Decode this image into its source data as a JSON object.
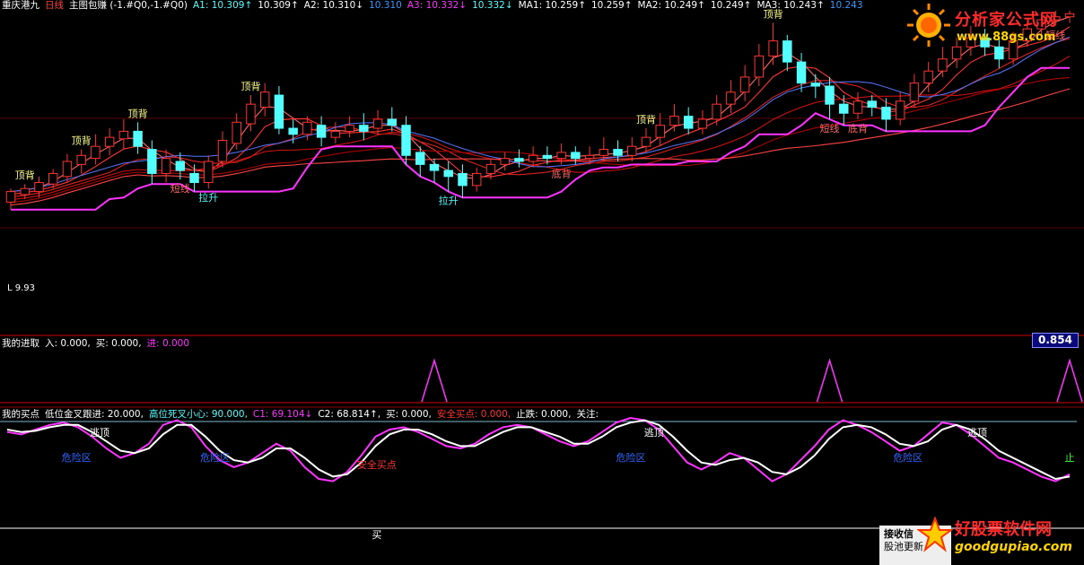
{
  "colors": {
    "bg": "#000000",
    "up_candle": "#ff3333",
    "down_candle": "#54ffff",
    "divider": "#7a0000",
    "ma_red": "#ff2a2a",
    "stop_line_magenta": "#ff33ff",
    "green_line": "#33ff33",
    "blue_dots": "#4466ff",
    "white_line": "#ffffff",
    "yellow_text": "#ffff00",
    "cyan_text": "#54ffff"
  },
  "header": {
    "stock": "重庆港九",
    "period": "日线",
    "indicator": "主图包赚 (-1.#Q0,-1.#Q0)",
    "a1": "A1: 10.309↑",
    "a1b": "10.309↑",
    "a2": "A2: 10.310↓",
    "a2b": "10.310",
    "a3": "A3: 10.332↓",
    "a3b": "10.332↓",
    "ma1": "MA1: 10.259↑",
    "ma1b": "10.259↑",
    "ma2": "MA2: 10.249↑",
    "ma2b": "10.249↑",
    "ma3": "MA3: 10.243↑",
    "ma3b": "10.243"
  },
  "panel2": {
    "title": "我的进取",
    "ru": "入: 0.000,",
    "mai": "买: 0.000,",
    "jin": "进: 0.000",
    "value_box": "0.854"
  },
  "panel3": {
    "title": "我的买点",
    "p1": "低位金叉跟进: 20.000,",
    "p2": "高位死叉小心: 90.000,",
    "c1": "C1: 69.104↓",
    "c2": "C2: 68.814↑,",
    "buy": "买: 0.000,",
    "safe": "安全买点: 0.000,",
    "stop": "止跌: 0.000,",
    "watch": "关注:"
  },
  "watermark_top": {
    "name": "分析家公式网",
    "url": "www.88gs.com"
  },
  "watermark_bottom": {
    "name": "好股票软件网",
    "url": "goodgupiao.com",
    "notice1": "接收信",
    "notice2": "股池更新"
  },
  "chart_data": [
    {
      "type": "candlestick",
      "price_range": [
        9.2,
        11.2
      ],
      "low_label": "L 9.93",
      "candles": [
        [
          9.93,
          10.0,
          9.88,
          10.02
        ],
        [
          9.98,
          10.02,
          9.95,
          10.05
        ],
        [
          10.0,
          10.06,
          9.96,
          10.1
        ],
        [
          10.05,
          10.12,
          10.02,
          10.15
        ],
        [
          10.1,
          10.2,
          10.06,
          10.25
        ],
        [
          10.18,
          10.24,
          10.12,
          10.28
        ],
        [
          10.22,
          10.3,
          10.18,
          10.38
        ],
        [
          10.3,
          10.36,
          10.24,
          10.42
        ],
        [
          10.35,
          10.4,
          10.28,
          10.48
        ],
        [
          10.4,
          10.3,
          10.25,
          10.46
        ],
        [
          10.28,
          10.12,
          10.05,
          10.34
        ],
        [
          10.12,
          10.22,
          10.06,
          10.28
        ],
        [
          10.2,
          10.14,
          10.08,
          10.26
        ],
        [
          10.12,
          10.06,
          10.0,
          10.18
        ],
        [
          10.06,
          10.2,
          10.02,
          10.24
        ],
        [
          10.2,
          10.34,
          10.16,
          10.4
        ],
        [
          10.32,
          10.46,
          10.28,
          10.52
        ],
        [
          10.45,
          10.58,
          10.4,
          10.64
        ],
        [
          10.56,
          10.66,
          10.5,
          10.72
        ],
        [
          10.64,
          10.42,
          10.38,
          10.7
        ],
        [
          10.42,
          10.38,
          10.32,
          10.48
        ],
        [
          10.38,
          10.46,
          10.34,
          10.5
        ],
        [
          10.44,
          10.36,
          10.3,
          10.5
        ],
        [
          10.36,
          10.4,
          10.32,
          10.46
        ],
        [
          10.4,
          10.44,
          10.36,
          10.5
        ],
        [
          10.44,
          10.4,
          10.34,
          10.52
        ],
        [
          10.42,
          10.48,
          10.38,
          10.54
        ],
        [
          10.48,
          10.44,
          10.4,
          10.56
        ],
        [
          10.44,
          10.24,
          10.18,
          10.5
        ],
        [
          10.26,
          10.18,
          10.1,
          10.3
        ],
        [
          10.18,
          10.14,
          10.06,
          10.22
        ],
        [
          10.14,
          10.1,
          10.0,
          10.2
        ],
        [
          10.12,
          10.04,
          9.96,
          10.18
        ],
        [
          10.04,
          10.12,
          10.0,
          10.16
        ],
        [
          10.12,
          10.18,
          10.08,
          10.22
        ],
        [
          10.18,
          10.22,
          10.14,
          10.26
        ],
        [
          10.22,
          10.2,
          10.16,
          10.28
        ],
        [
          10.2,
          10.24,
          10.16,
          10.3
        ],
        [
          10.24,
          10.22,
          10.18,
          10.3
        ],
        [
          10.22,
          10.26,
          10.18,
          10.32
        ],
        [
          10.26,
          10.22,
          10.18,
          10.3
        ],
        [
          10.22,
          10.24,
          10.18,
          10.3
        ],
        [
          10.24,
          10.28,
          10.2,
          10.36
        ],
        [
          10.28,
          10.24,
          10.2,
          10.34
        ],
        [
          10.24,
          10.3,
          10.2,
          10.36
        ],
        [
          10.3,
          10.36,
          10.26,
          10.42
        ],
        [
          10.36,
          10.44,
          10.3,
          10.52
        ],
        [
          10.44,
          10.5,
          10.4,
          10.58
        ],
        [
          10.5,
          10.42,
          10.38,
          10.56
        ],
        [
          10.42,
          10.48,
          10.38,
          10.54
        ],
        [
          10.48,
          10.58,
          10.44,
          10.64
        ],
        [
          10.58,
          10.66,
          10.52,
          10.74
        ],
        [
          10.66,
          10.76,
          10.6,
          10.84
        ],
        [
          10.76,
          10.9,
          10.7,
          10.98
        ],
        [
          10.9,
          11.0,
          10.84,
          11.12
        ],
        [
          11.0,
          10.86,
          10.8,
          11.04
        ],
        [
          10.86,
          10.72,
          10.66,
          10.92
        ],
        [
          10.72,
          10.7,
          10.62,
          10.78
        ],
        [
          10.7,
          10.58,
          10.48,
          10.76
        ],
        [
          10.58,
          10.52,
          10.44,
          10.64
        ],
        [
          10.52,
          10.6,
          10.48,
          10.66
        ],
        [
          10.6,
          10.56,
          10.5,
          10.64
        ],
        [
          10.56,
          10.48,
          10.4,
          10.62
        ],
        [
          10.48,
          10.6,
          10.44,
          10.66
        ],
        [
          10.6,
          10.72,
          10.56,
          10.78
        ],
        [
          10.72,
          10.8,
          10.66,
          10.86
        ],
        [
          10.8,
          10.88,
          10.76,
          10.96
        ],
        [
          10.88,
          10.96,
          10.82,
          11.02
        ],
        [
          10.96,
          11.02,
          10.9,
          11.1
        ],
        [
          11.02,
          10.96,
          10.9,
          11.08
        ],
        [
          10.96,
          10.88,
          10.82,
          11.02
        ],
        [
          10.88,
          11.0,
          10.84,
          11.06
        ],
        [
          11.0,
          11.08,
          10.96,
          11.12
        ],
        [
          11.08,
          11.14,
          11.04,
          11.18
        ],
        [
          11.14,
          11.16,
          11.1,
          11.2
        ],
        [
          11.16,
          11.18,
          11.12,
          11.2
        ]
      ],
      "signals": [
        {
          "label": "顶背",
          "i": 1
        },
        {
          "label": "顶背",
          "i": 5
        },
        {
          "label": "顶背",
          "i": 9
        },
        {
          "label": "顶背",
          "i": 17
        },
        {
          "label": "短线",
          "i": 12
        },
        {
          "label": "拉升",
          "i": 14
        },
        {
          "label": "拉升",
          "i": 31
        },
        {
          "label": "底背",
          "i": 39
        },
        {
          "label": "顶背",
          "i": 45
        },
        {
          "label": "顶背",
          "i": 54
        },
        {
          "label": "短线",
          "i": 58
        },
        {
          "label": "底背",
          "i": 60
        },
        {
          "label": "短线",
          "i": 74
        }
      ]
    },
    {
      "type": "line",
      "name": "我的进取",
      "peaks_at": [
        30,
        58,
        75
      ]
    },
    {
      "type": "line",
      "name": "我的买点",
      "ylim": [
        0,
        100
      ],
      "series": [
        {
          "name": "C1",
          "values": [
            82,
            80,
            84,
            88,
            90,
            86,
            78,
            68,
            60,
            64,
            72,
            88,
            92,
            86,
            70,
            58,
            52,
            56,
            64,
            72,
            66,
            52,
            42,
            40,
            48,
            62,
            78,
            84,
            86,
            82,
            76,
            70,
            68,
            72,
            80,
            86,
            88,
            86,
            80,
            74,
            70,
            74,
            82,
            90,
            94,
            92,
            84,
            70,
            56,
            50,
            56,
            64,
            60,
            50,
            40,
            46,
            58,
            70,
            84,
            92,
            88,
            82,
            74,
            66,
            70,
            80,
            90,
            88,
            80,
            70,
            60,
            56,
            50,
            44,
            40,
            46
          ]
        },
        {
          "name": "C2",
          "values": [
            84,
            82,
            83,
            86,
            88,
            88,
            82,
            74,
            66,
            64,
            68,
            80,
            88,
            88,
            78,
            66,
            58,
            56,
            60,
            68,
            68,
            60,
            50,
            44,
            46,
            56,
            70,
            80,
            84,
            84,
            80,
            74,
            70,
            70,
            76,
            82,
            86,
            86,
            82,
            78,
            72,
            72,
            78,
            86,
            90,
            92,
            88,
            78,
            66,
            56,
            54,
            58,
            60,
            56,
            48,
            46,
            52,
            62,
            76,
            86,
            88,
            86,
            80,
            72,
            70,
            74,
            84,
            88,
            84,
            76,
            66,
            60,
            54,
            48,
            42,
            44
          ]
        }
      ],
      "labels": [
        {
          "text": "逃顶",
          "i": 4
        },
        {
          "text": "危险区",
          "i": 3
        },
        {
          "text": "危险区",
          "i": 9
        },
        {
          "text": "安全买点",
          "i": 16
        },
        {
          "text": "买",
          "i": 16
        },
        {
          "text": "危险区",
          "i": 27
        },
        {
          "text": "逃顶",
          "i": 28
        },
        {
          "text": "危险区",
          "i": 39
        },
        {
          "text": "逃顶",
          "i": 42
        },
        {
          "text": "止",
          "i": 46
        }
      ]
    }
  ]
}
